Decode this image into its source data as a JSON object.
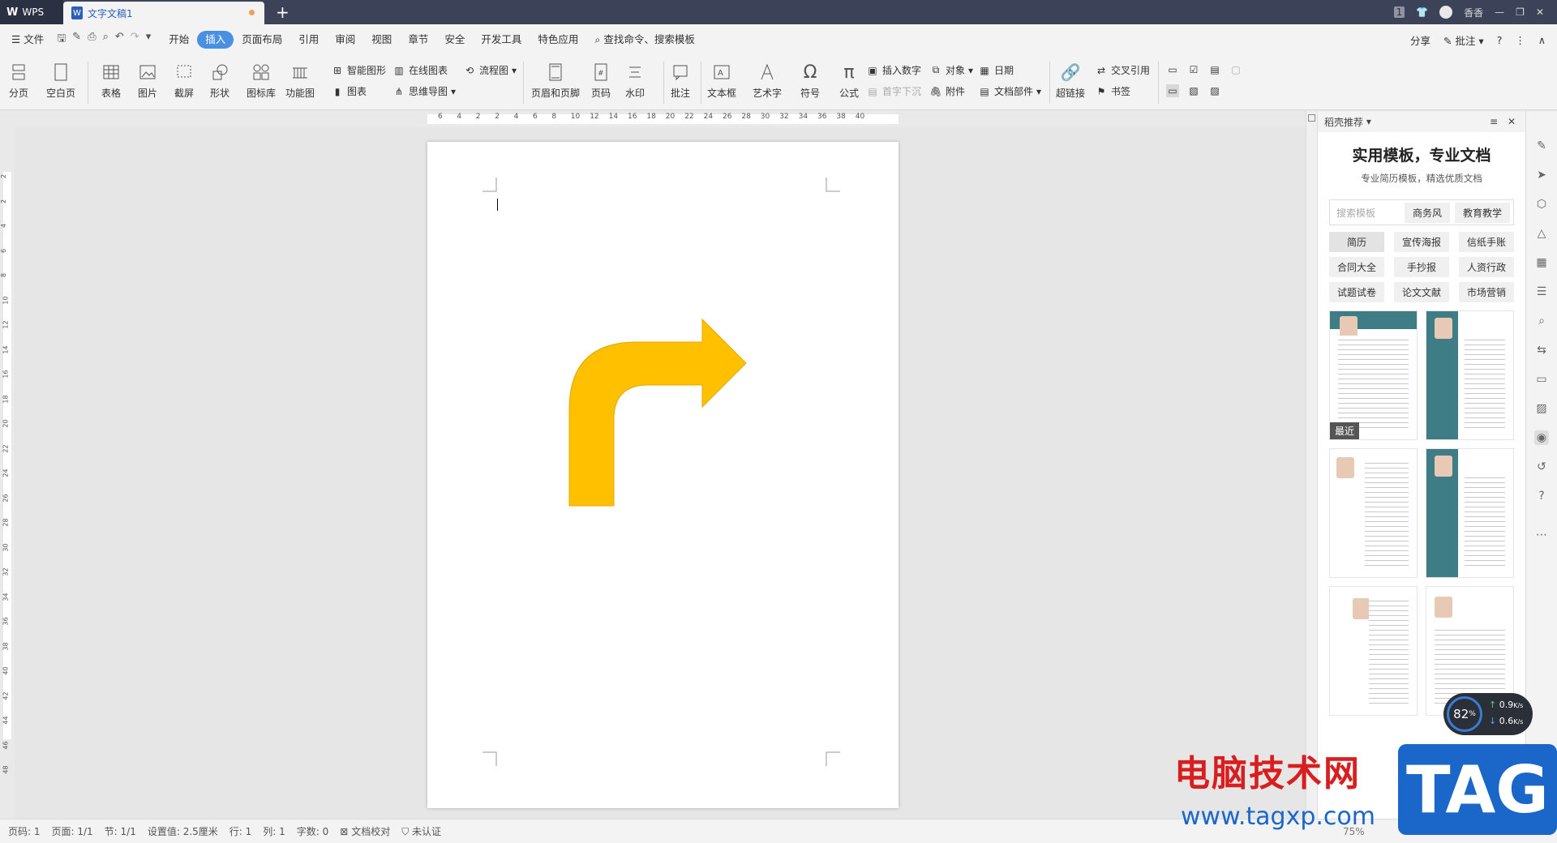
{
  "titlebar": {
    "app_tab": "WPS",
    "doc_tab": "文字文稿1",
    "new_tab_glyph": "+",
    "page_badge": "1",
    "user_name": "香香"
  },
  "menubar": {
    "file": "文件",
    "tabs": [
      "开始",
      "插入",
      "页面布局",
      "引用",
      "审阅",
      "视图",
      "章节",
      "安全",
      "开发工具",
      "特色应用"
    ],
    "active_tab": "插入",
    "search": "查找命令、搜索模板",
    "share": "分享",
    "comment": "批注"
  },
  "ribbon": {
    "page_break": "分页",
    "blank_page": "空白页",
    "table": "表格",
    "picture": "图片",
    "screenshot": "截屏",
    "shape": "形状",
    "icon_lib": "图标库",
    "func_chart": "功能图",
    "smart_shape": "智能图形",
    "online_chart": "在线图表",
    "flowchart": "流程图",
    "chart": "图表",
    "mindmap": "思维导图",
    "header_footer": "页眉和页脚",
    "page_number": "页码",
    "watermark": "水印",
    "comment": "批注",
    "textbox": "文本框",
    "wordart": "艺术字",
    "symbol": "符号",
    "formula": "公式",
    "insert_number": "插入数字",
    "dropcap": "首字下沉",
    "object": "对象",
    "attachment": "附件",
    "date": "日期",
    "doc_parts": "文档部件",
    "hyperlink": "超链接",
    "cross_ref": "交叉引用",
    "bookmark": "书签"
  },
  "ruler": {
    "h_ticks": [
      "6",
      "4",
      "2",
      "2",
      "4",
      "6",
      "8",
      "10",
      "12",
      "14",
      "16",
      "18",
      "20",
      "22",
      "24",
      "26",
      "28",
      "30",
      "32",
      "34",
      "36",
      "38",
      "40"
    ],
    "v_ticks": [
      "2",
      "2",
      "4",
      "6",
      "8",
      "10",
      "12",
      "14",
      "16",
      "18",
      "20",
      "22",
      "24",
      "26",
      "28",
      "30",
      "32",
      "34",
      "36",
      "38",
      "40",
      "42",
      "44",
      "46",
      "48"
    ]
  },
  "shape": {
    "type": "bent-arrow",
    "fill": "#FFC000",
    "stroke": "#E0A800"
  },
  "panel": {
    "header": "稻壳推荐",
    "title": "实用模板，专业文档",
    "subtitle": "专业简历模板，精选优质文档",
    "search_placeholder": "搜索模板",
    "search_tags": [
      "商务风",
      "教育教学"
    ],
    "chips": [
      "简历",
      "宣传海报",
      "信纸手账",
      "合同大全",
      "手抄报",
      "人资行政",
      "试题试卷",
      "论文文献",
      "市场营销"
    ],
    "recent_label": "最近"
  },
  "status": {
    "page_code": "页码: 1",
    "page": "页面: 1/1",
    "section": "节: 1/1",
    "setting": "设置值: 2.5厘米",
    "row": "行: 1",
    "col": "列: 1",
    "words": "字数: 0",
    "proof": "文档校对",
    "auth": "未认证",
    "zoom": "75%"
  },
  "speed_widget": {
    "percent": "82",
    "percent_sign": "%",
    "up": "0.9",
    "down": "0.6",
    "unit": "K/s"
  },
  "watermark": {
    "cn": "电脑技术网",
    "url": "www.tagxp.com",
    "tag": "TAG"
  },
  "colors": {
    "accent": "#4a90e2",
    "titlebar": "#3c4257",
    "arrow": "#FFC000"
  }
}
